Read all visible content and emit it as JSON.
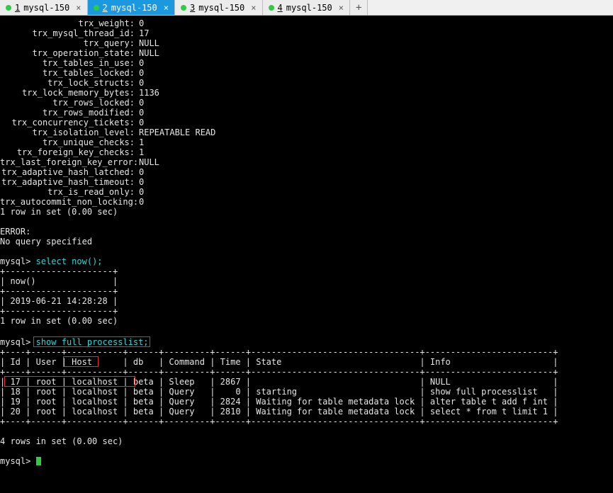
{
  "tabs": [
    {
      "num": "1",
      "label": "mysql-150",
      "active": false
    },
    {
      "num": "2",
      "label": "mysql-150",
      "active": true
    },
    {
      "num": "3",
      "label": "mysql-150",
      "active": false
    },
    {
      "num": "4",
      "label": "mysql-150",
      "active": false
    }
  ],
  "trx_fields": [
    {
      "k": "trx_weight",
      "v": "0"
    },
    {
      "k": "trx_mysql_thread_id",
      "v": "17"
    },
    {
      "k": "trx_query",
      "v": "NULL"
    },
    {
      "k": "trx_operation_state",
      "v": "NULL"
    },
    {
      "k": "trx_tables_in_use",
      "v": "0"
    },
    {
      "k": "trx_tables_locked",
      "v": "0"
    },
    {
      "k": "trx_lock_structs",
      "v": "0"
    },
    {
      "k": "trx_lock_memory_bytes",
      "v": "1136"
    },
    {
      "k": "trx_rows_locked",
      "v": "0"
    },
    {
      "k": "trx_rows_modified",
      "v": "0"
    },
    {
      "k": "trx_concurrency_tickets",
      "v": "0"
    },
    {
      "k": "trx_isolation_level",
      "v": "REPEATABLE READ"
    },
    {
      "k": "trx_unique_checks",
      "v": "1"
    },
    {
      "k": "trx_foreign_key_checks",
      "v": "1"
    },
    {
      "k": "trx_last_foreign_key_error",
      "v": "NULL"
    },
    {
      "k": "trx_adaptive_hash_latched",
      "v": "0"
    },
    {
      "k": "trx_adaptive_hash_timeout",
      "v": "0"
    },
    {
      "k": "trx_is_read_only",
      "v": "0"
    },
    {
      "k": "trx_autocommit_non_locking",
      "v": "0"
    }
  ],
  "row_summary1": "1 row in set (0.00 sec)",
  "error_label": "ERROR:",
  "error_msg": "No query specified",
  "prompt1": "mysql>",
  "cmd_now": "select now();",
  "now_border": "+---------------------+",
  "now_head": "| now()               |",
  "now_value": "| 2019-06-21 14:28:28 |",
  "row_summary2": "1 row in set (0.00 sec)",
  "cmd_proc": "show full processlist;",
  "proc_border": "+----+------+-----------+------+---------+------+---------------------------------+-------------------------+",
  "proc_head": "| Id | User | Host      | db   | Command | Time | State                           | Info                    |",
  "proc_rows": [
    "| 17 | root | localhost | beta | Sleep   | 2867 |                                 | NULL                    |",
    "| 18 | root | localhost | beta | Query   |    0 | starting                        | show full processlist   |",
    "| 19 | root | localhost | beta | Query   | 2824 | Waiting for table metadata lock | alter table t add f int |",
    "| 20 | root | localhost | beta | Query   | 2810 | Waiting for table metadata lock | select * from t limit 1 |"
  ],
  "row_summary3": "4 rows in set (0.00 sec)",
  "prompt_final": "mysql>"
}
